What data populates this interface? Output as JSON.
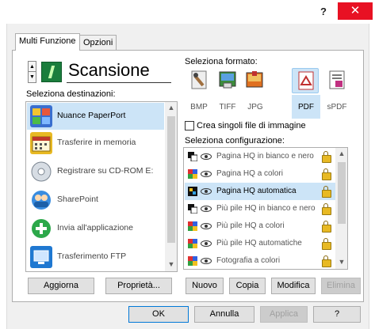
{
  "titlebar": {
    "help": "?",
    "close": "✕"
  },
  "tabs": [
    {
      "label": "Multi Funzione"
    },
    {
      "label": "Opzioni"
    }
  ],
  "scan": {
    "title": "Scansione"
  },
  "destinations": {
    "label": "Seleziona destinazioni:",
    "items": [
      {
        "label": "Nuance PaperPort",
        "icon": "paperport-icon",
        "color": "#3a6fcf"
      },
      {
        "label": "Trasferire in memoria",
        "icon": "calendar-icon",
        "color": "#e8b923"
      },
      {
        "label": "Registrare su CD-ROM  E:",
        "icon": "cd-icon",
        "color": "#9aa4b0"
      },
      {
        "label": "SharePoint",
        "icon": "sharepoint-icon",
        "color": "#3a8de0"
      },
      {
        "label": "Invia all'applicazione",
        "icon": "send-app-icon",
        "color": "#2ca84a"
      },
      {
        "label": "Trasferimento FTP",
        "icon": "ftp-icon",
        "color": "#1f78d1"
      }
    ]
  },
  "formats": {
    "label": "Seleziona formato:",
    "items": [
      {
        "label": "BMP"
      },
      {
        "label": "TIFF"
      },
      {
        "label": "JPG"
      },
      {
        "label": "PDF"
      },
      {
        "label": "sPDF"
      }
    ],
    "selected": "PDF"
  },
  "single_files": {
    "label": "Crea singoli file di immagine",
    "checked": false
  },
  "configurations": {
    "label": "Seleziona configurazione:",
    "items": [
      {
        "label": "Pagina HQ in bianco e nero"
      },
      {
        "label": "Pagina HQ a colori"
      },
      {
        "label": "Pagina HQ automatica"
      },
      {
        "label": "Più pile HQ in bianco e nero"
      },
      {
        "label": "Più pile HQ a colori"
      },
      {
        "label": "Più pile HQ automatiche"
      },
      {
        "label": "Fotografia a colori"
      }
    ]
  },
  "left_buttons": {
    "refresh": "Aggiorna",
    "properties": "Proprietà..."
  },
  "config_buttons": {
    "new": "Nuovo",
    "copy": "Copia",
    "edit": "Modifica",
    "delete": "Elimina"
  },
  "dialog_buttons": {
    "ok": "OK",
    "cancel": "Annulla",
    "apply": "Applica",
    "help": "?"
  },
  "colors": {
    "selection": "#cce4f7",
    "close": "#e81123",
    "accent": "#0078d7"
  }
}
